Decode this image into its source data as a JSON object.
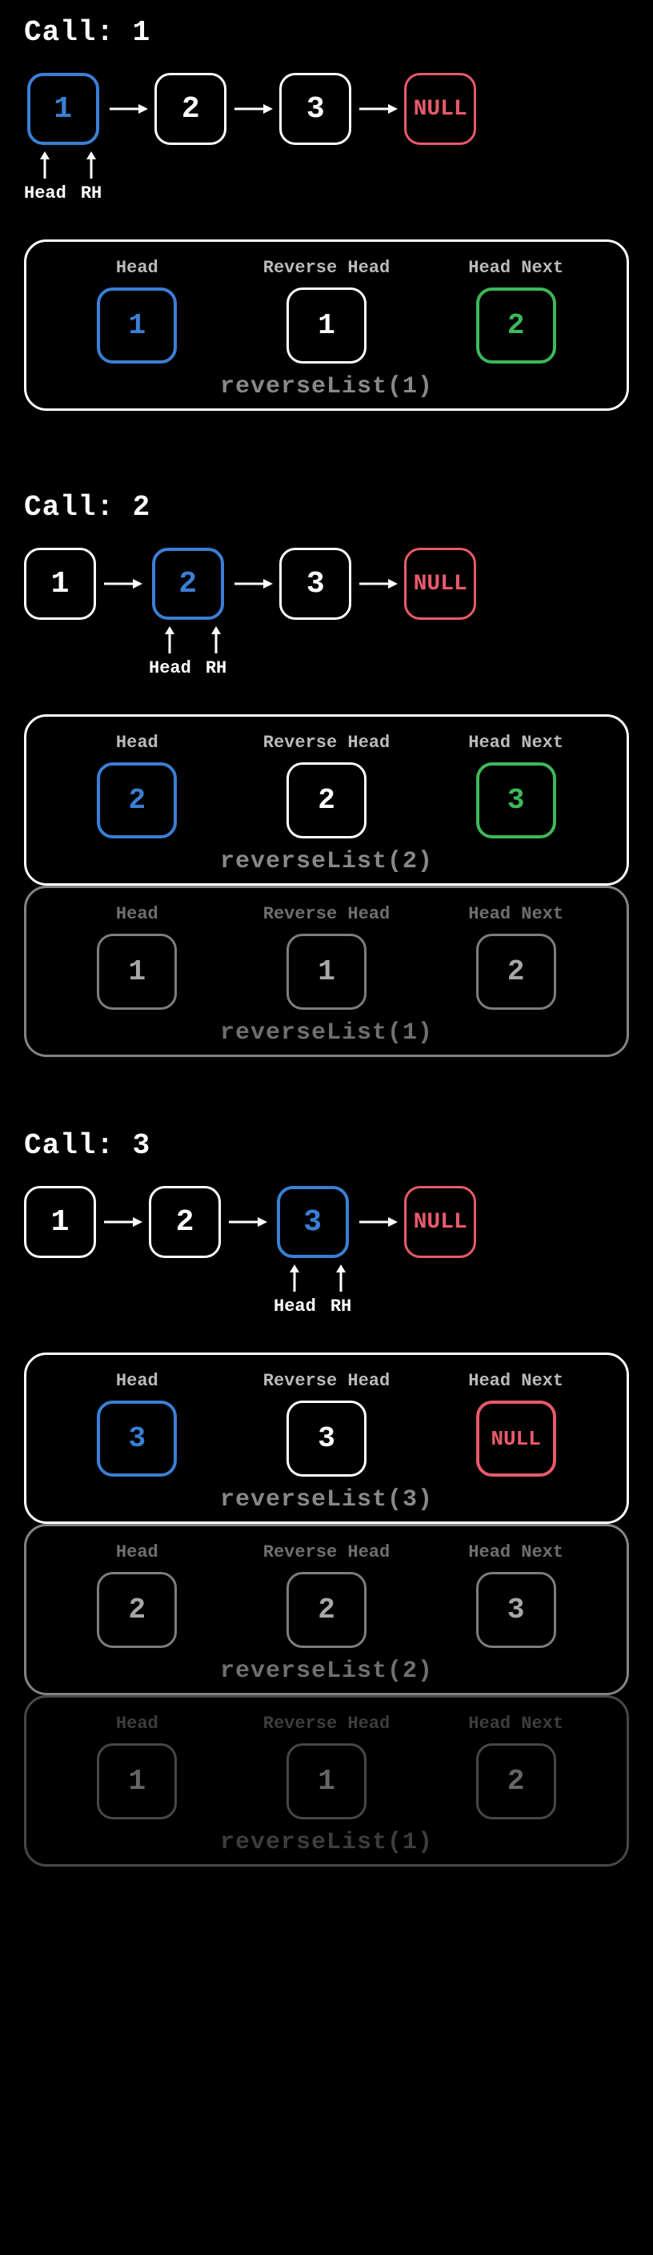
{
  "labels": {
    "head": "Head",
    "rh": "RH",
    "reverse_head": "Reverse Head",
    "head_next": "Head Next",
    "null": "NULL"
  },
  "calls": [
    {
      "title": "Call: 1",
      "nodes": [
        "1",
        "2",
        "3",
        "NULL"
      ],
      "highlight_index": 0,
      "frames": [
        {
          "fn": "reverseList(1)",
          "head": "1",
          "rh": "1",
          "next": "2",
          "dim": 0
        }
      ]
    },
    {
      "title": "Call: 2",
      "nodes": [
        "1",
        "2",
        "3",
        "NULL"
      ],
      "highlight_index": 1,
      "frames": [
        {
          "fn": "reverseList(2)",
          "head": "2",
          "rh": "2",
          "next": "3",
          "dim": 0
        },
        {
          "fn": "reverseList(1)",
          "head": "1",
          "rh": "1",
          "next": "2",
          "dim": 1
        }
      ]
    },
    {
      "title": "Call: 3",
      "nodes": [
        "1",
        "2",
        "3",
        "NULL"
      ],
      "highlight_index": 2,
      "frames": [
        {
          "fn": "reverseList(3)",
          "head": "3",
          "rh": "3",
          "next": "NULL",
          "dim": 0
        },
        {
          "fn": "reverseList(2)",
          "head": "2",
          "rh": "2",
          "next": "3",
          "dim": 1
        },
        {
          "fn": "reverseList(1)",
          "head": "1",
          "rh": "1",
          "next": "2",
          "dim": 2
        }
      ]
    }
  ]
}
